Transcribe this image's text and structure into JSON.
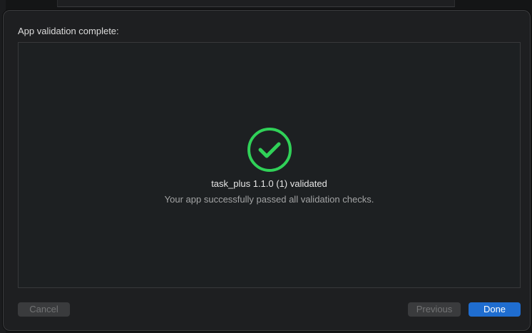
{
  "dialog": {
    "title": "App validation complete:",
    "result_title": "task_plus 1.1.0 (1) validated",
    "result_subtitle": "Your app successfully passed all validation checks.",
    "status_icon": "checkmark-circle-icon",
    "status_color": "#30d158"
  },
  "buttons": {
    "cancel_label": "Cancel",
    "previous_label": "Previous",
    "done_label": "Done",
    "accent_color": "#1f6dd0"
  }
}
